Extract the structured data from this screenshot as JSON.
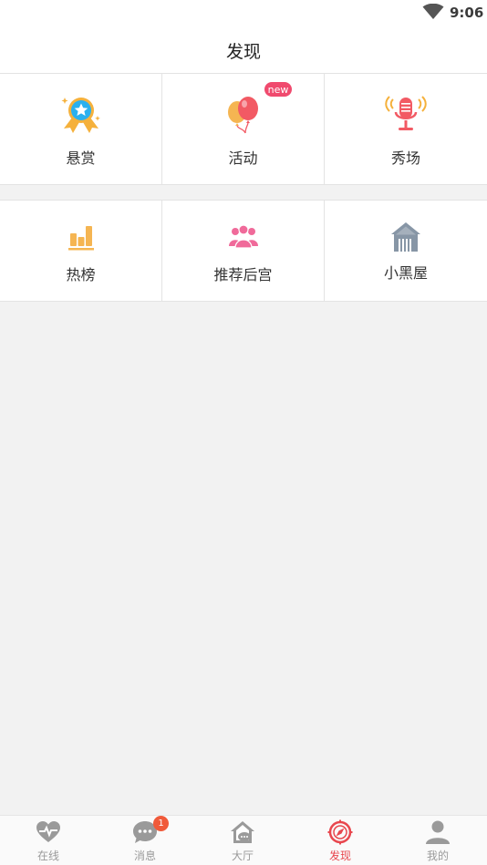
{
  "status_bar": {
    "time": "9:06",
    "wifi_icon": "wifi-icon"
  },
  "header": {
    "title": "发现"
  },
  "grid": {
    "row1": [
      {
        "label": "悬赏",
        "icon": "award-ribbon-icon"
      },
      {
        "label": "活动",
        "icon": "balloons-icon",
        "badge": "new"
      },
      {
        "label": "秀场",
        "icon": "microphone-icon"
      }
    ],
    "row2": [
      {
        "label": "热榜",
        "icon": "bar-chart-icon"
      },
      {
        "label": "推荐后宫",
        "icon": "people-group-icon"
      },
      {
        "label": "小黑屋",
        "icon": "house-icon"
      }
    ]
  },
  "tabbar": {
    "tabs": [
      {
        "label": "在线",
        "icon": "heartbeat-icon",
        "active": false
      },
      {
        "label": "消息",
        "icon": "chat-bubble-icon",
        "active": false,
        "badge": "1"
      },
      {
        "label": "大厅",
        "icon": "hall-house-icon",
        "active": false
      },
      {
        "label": "发现",
        "icon": "compass-icon",
        "active": true
      },
      {
        "label": "我的",
        "icon": "person-icon",
        "active": false
      }
    ]
  },
  "colors": {
    "accent": "#e8474e",
    "inactive_tab": "#9a9a9a",
    "badge_new": "#f04a6e",
    "message_badge": "#f05a3a",
    "background": "#f2f2f2"
  }
}
